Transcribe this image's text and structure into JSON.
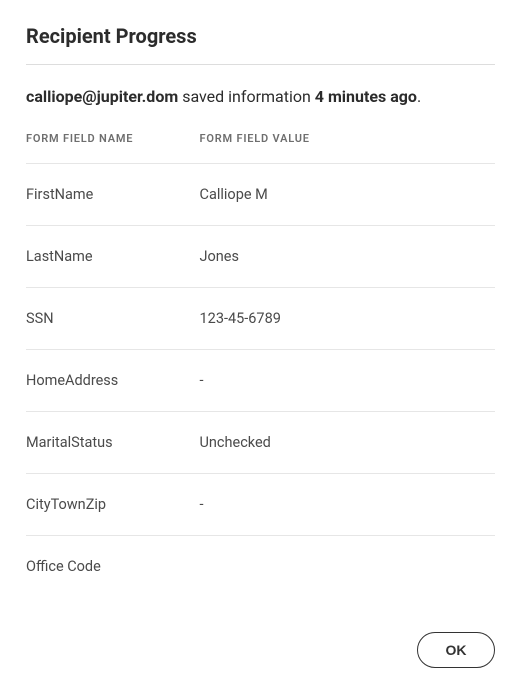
{
  "title": "Recipient Progress",
  "status": {
    "email": "calliope@jupiter.dom",
    "middleText": " saved information ",
    "time": "4 minutes ago",
    "suffix": "."
  },
  "headers": {
    "fieldName": "FORM FIELD NAME",
    "fieldValue": "FORM FIELD VALUE"
  },
  "rows": [
    {
      "name": "FirstName",
      "value": "Calliope M"
    },
    {
      "name": "LastName",
      "value": "Jones"
    },
    {
      "name": "SSN",
      "value": "123-45-6789"
    },
    {
      "name": "HomeAddress",
      "value": "-"
    },
    {
      "name": "MaritalStatus",
      "value": "Unchecked"
    },
    {
      "name": "CityTownZip",
      "value": "-"
    },
    {
      "name": "Office Code",
      "value": ""
    }
  ],
  "buttons": {
    "ok": "OK"
  }
}
